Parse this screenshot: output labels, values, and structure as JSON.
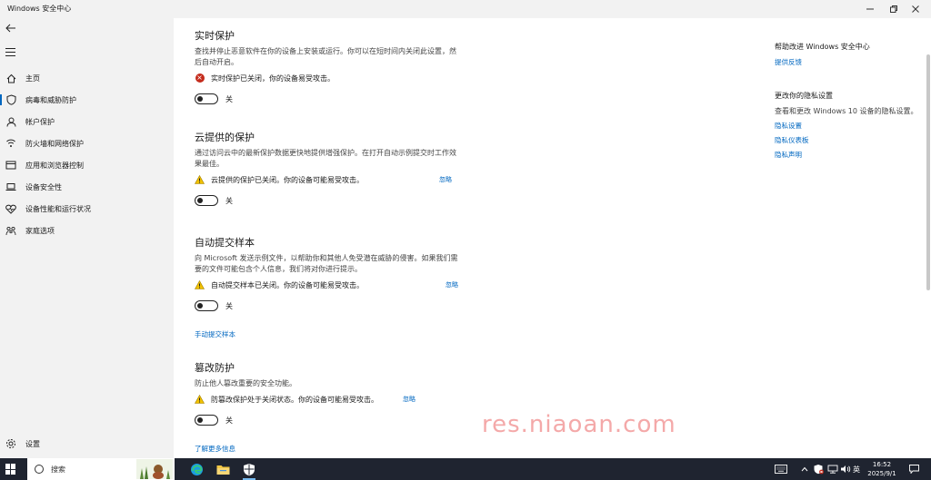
{
  "window": {
    "title": "Windows 安全中心"
  },
  "sidebar": {
    "items": [
      {
        "label": "主页"
      },
      {
        "label": "病毒和威胁防护"
      },
      {
        "label": "帐户保护"
      },
      {
        "label": "防火墙和网络保护"
      },
      {
        "label": "应用和浏览器控制"
      },
      {
        "label": "设备安全性"
      },
      {
        "label": "设备性能和运行状况"
      },
      {
        "label": "家庭选项"
      }
    ],
    "settings_label": "设置"
  },
  "sections": [
    {
      "title": "实时保护",
      "desc": "查找并停止恶意软件在你的设备上安装或运行。你可以在短时间内关闭此设置，然后自动开启。",
      "status": "实时保护已关闭，你的设备易受攻击。",
      "status_type": "error",
      "toggle_label": "关"
    },
    {
      "title": "云提供的保护",
      "desc": "通过访问云中的最新保护数据更快地提供增强保护。在打开自动示例提交时工作效果最佳。",
      "status": "云提供的保护已关闭。你的设备可能易受攻击。",
      "status_type": "warning",
      "ignore": "忽略",
      "toggle_label": "关"
    },
    {
      "title": "自动提交样本",
      "desc": "向 Microsoft 发送示例文件，以帮助你和其他人免受潜在威胁的侵害。如果我们需要的文件可能包含个人信息，我们将对你进行提示。",
      "status": "自动提交样本已关闭。你的设备可能易受攻击。",
      "status_type": "warning",
      "ignore": "忽略",
      "toggle_label": "关",
      "link": "手动提交样本"
    },
    {
      "title": "篡改防护",
      "desc": "防止他人篡改重要的安全功能。",
      "status": "防篡改保护处于关闭状态。你的设备可能易受攻击。",
      "status_type": "warning",
      "ignore": "忽略",
      "toggle_label": "关",
      "link": "了解更多信息"
    }
  ],
  "right_panel": {
    "help_title": "帮助改进 Windows 安全中心",
    "feedback_link": "提供反馈",
    "privacy_title": "更改你的隐私设置",
    "privacy_desc": "查看和更改 Windows 10 设备的隐私设置。",
    "links": [
      "隐私设置",
      "隐私仪表板",
      "隐私声明"
    ]
  },
  "watermark": "res.niaoan.com",
  "taskbar": {
    "search_placeholder": "搜索",
    "ime": "英",
    "time": "16:52",
    "date": "2025/9/1"
  },
  "colors": {
    "accent": "#0067c0",
    "error": "#c42b1c",
    "warning": "#f2c200",
    "sidebar_bg": "#f2f2f2",
    "taskbar_bg": "#1f2430"
  }
}
